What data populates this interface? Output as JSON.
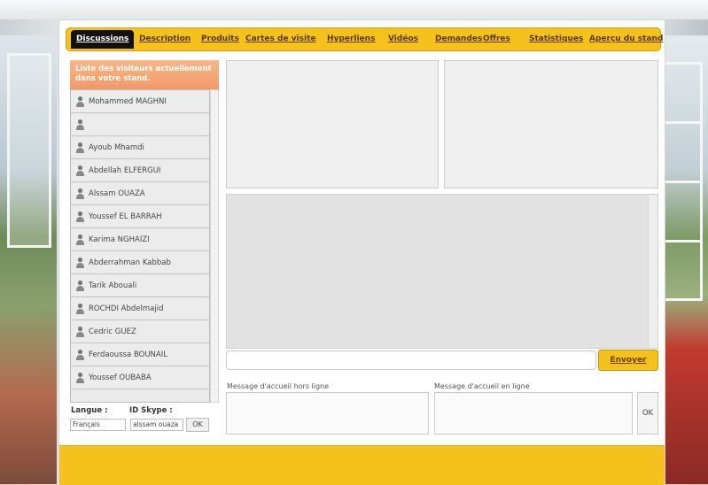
{
  "navbar": {
    "tabs": [
      {
        "label": "Discussions",
        "active": true
      },
      {
        "label": "Description"
      },
      {
        "label": "Produits"
      },
      {
        "label": "Cartes de visite"
      },
      {
        "label": "Hyperliens"
      },
      {
        "label": "Vidéos"
      },
      {
        "label": "Demandes"
      },
      {
        "label": "Offres"
      },
      {
        "label": "Statistiques"
      },
      {
        "label": "Aperçu du stand"
      }
    ]
  },
  "visitors": {
    "header": "Liste des visiteurs actuellement dans votre stand.",
    "items": [
      "Mohammed MAGHNI",
      "",
      "Ayoub Mhamdi",
      "Abdellah ELFERGUI",
      "Alssam OUAZA",
      "Youssef EL BARRAH",
      "Karima NGHAIZI",
      "Abderrahman Kabbab",
      "Tarik Abouali",
      "ROCHDI Abdelmajid",
      "Cedric GUEZ",
      "Ferdaoussa BOUNAIL",
      "Youssef OUBABA"
    ]
  },
  "chat": {
    "input_value": "",
    "send_label": "Envoyer"
  },
  "messages": {
    "offline_label": "Message d'accueil hors ligne",
    "online_label": "Message d'accueil en ligne",
    "ok_label": "OK"
  },
  "settings": {
    "language_label": "Langue :",
    "skype_label": "ID Skype :",
    "language_value": "Français",
    "skype_value": "alssam ouaza",
    "ok_label": "OK"
  },
  "colors": {
    "accent": "#f5c21d",
    "header_orange": "#f29968",
    "active_tab": "#111111"
  }
}
